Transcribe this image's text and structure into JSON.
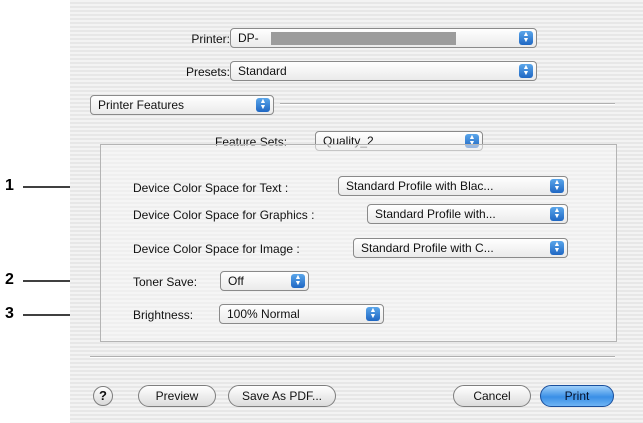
{
  "dialog": {
    "printer_label": "Printer:",
    "printer_value": "DP-",
    "presets_label": "Presets:",
    "presets_value": "Standard",
    "panel_popup_value": "Printer Features",
    "feature_sets_label": "Feature Sets:",
    "feature_sets_value": "Quality_2",
    "settings": [
      {
        "label": "Device Color Space for Text :",
        "value": "Standard Profile with Blac..."
      },
      {
        "label": "Device Color Space for Graphics :",
        "value": "Standard Profile with..."
      },
      {
        "label": "Device Color Space for Image :",
        "value": "Standard Profile with C..."
      },
      {
        "label": "Toner Save:",
        "value": "Off"
      },
      {
        "label": "Brightness:",
        "value": "100% Normal"
      }
    ],
    "buttons": {
      "help": "?",
      "preview": "Preview",
      "save_pdf": "Save As PDF...",
      "cancel": "Cancel",
      "print": "Print"
    }
  },
  "callouts": [
    "1",
    "2",
    "3"
  ],
  "colors": {
    "accent_blue": "#2a78d6",
    "redacted_gray": "#9c9c9c"
  }
}
